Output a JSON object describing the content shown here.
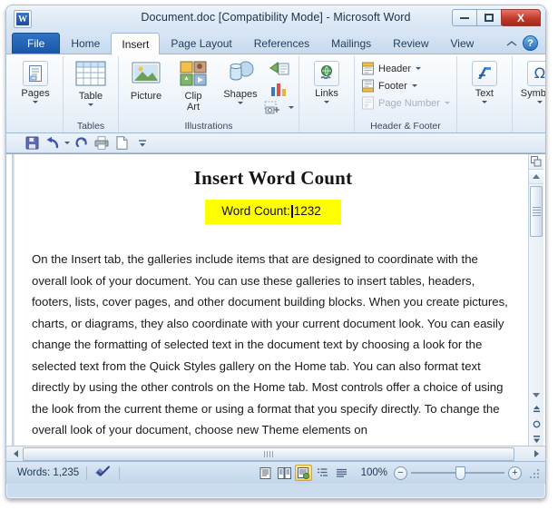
{
  "window": {
    "title": "Document.doc [Compatibility Mode]  -  Microsoft Word",
    "logo_letter": "W",
    "minimize_label": "Minimize",
    "maximize_label": "Restore",
    "close_label": "X"
  },
  "tabs": [
    {
      "label": "File",
      "type": "file"
    },
    {
      "label": "Home",
      "type": "normal"
    },
    {
      "label": "Insert",
      "type": "active"
    },
    {
      "label": "Page Layout",
      "type": "normal"
    },
    {
      "label": "References",
      "type": "normal"
    },
    {
      "label": "Mailings",
      "type": "normal"
    },
    {
      "label": "Review",
      "type": "normal"
    },
    {
      "label": "View",
      "type": "normal"
    }
  ],
  "tabstrip": {
    "collapse_ribbon_icon": "chevron-up-icon",
    "help_label": "?"
  },
  "ribbon": {
    "groups": [
      {
        "label": "",
        "buttons": [
          {
            "label": "Pages",
            "icon": "pages-icon",
            "dropdown": true
          }
        ]
      },
      {
        "label": "Tables",
        "buttons": [
          {
            "label": "Table",
            "icon": "table-icon",
            "dropdown": true
          }
        ]
      },
      {
        "label": "Illustrations",
        "buttons": [
          {
            "label": "Picture",
            "icon": "picture-icon",
            "dropdown": false
          },
          {
            "label": "Clip\nArt",
            "icon": "clip-art-icon",
            "dropdown": false
          },
          {
            "label": "Shapes",
            "icon": "shapes-icon",
            "dropdown": true
          },
          {
            "label": "",
            "icon": "smartart-chart-screenshot-icons",
            "dropdown": false
          }
        ]
      },
      {
        "label": "",
        "buttons": [
          {
            "label": "Links",
            "icon": "links-icon",
            "dropdown": true
          }
        ]
      },
      {
        "label": "Header & Footer",
        "small_buttons": [
          {
            "label": "Header",
            "icon": "header-icon",
            "dropdown": true,
            "disabled": false
          },
          {
            "label": "Footer",
            "icon": "footer-icon",
            "dropdown": true,
            "disabled": false
          },
          {
            "label": "Page Number",
            "icon": "page-number-icon",
            "dropdown": true,
            "disabled": true
          }
        ]
      },
      {
        "label": "",
        "buttons": [
          {
            "label": "Text",
            "icon": "text-icon",
            "dropdown": true
          }
        ]
      },
      {
        "label": "",
        "buttons": [
          {
            "label": "Symbols",
            "icon": "omega-symbol-icon",
            "dropdown": true
          }
        ]
      }
    ]
  },
  "quick_access_toolbar": {
    "items": [
      {
        "name": "save-icon",
        "tooltip": "Save"
      },
      {
        "name": "undo-icon",
        "tooltip": "Undo"
      },
      {
        "name": "undo-dropdown-icon",
        "tooltip": "Undo history"
      },
      {
        "name": "redo-icon",
        "tooltip": "Redo"
      },
      {
        "name": "print-preview-icon",
        "tooltip": "Print Preview and Print"
      },
      {
        "name": "new-document-icon",
        "tooltip": "New"
      },
      {
        "name": "customize-toolbar-icon",
        "tooltip": "Customize Quick Access Toolbar"
      }
    ]
  },
  "document": {
    "heading": "Insert Word Count",
    "highlight_label": "Word Count:",
    "highlight_value": "1232",
    "highlight_color": "#FFFF00",
    "body": "On the Insert tab, the galleries include items that are designed to coordinate with the overall look of your document. You can use these galleries to insert tables, headers, footers, lists, cover pages, and other document building blocks. When you create pictures, charts, or diagrams, they also coordinate with your current document look. You can easily change the formatting of selected text in the document text by choosing a look for the selected text from the Quick Styles gallery on the Home tab. You can also format text directly by using the other controls on the Home tab. Most controls offer a choice of using the look from the current theme or using a format that you specify directly. To change the overall look of your document, choose new Theme elements on"
  },
  "scrollbars": {
    "vertical": {
      "ruler_toggle_icon": "view-ruler-icon",
      "up_arrow_icon": "arrow-up-icon",
      "down_arrow_icon": "arrow-down-icon",
      "previous_page_icon": "previous-page-icon",
      "select_browse_object_icon": "select-browse-object-icon",
      "next_page_icon": "next-page-icon"
    },
    "horizontal": {
      "left_arrow_icon": "arrow-left-icon",
      "right_arrow_icon": "arrow-right-icon"
    }
  },
  "status_bar": {
    "word_count": "Words: 1,235",
    "proofing_icon": "proofing-errors-icon",
    "view_buttons": [
      {
        "name": "print-layout-view",
        "selected": false
      },
      {
        "name": "full-screen-reading-view",
        "selected": false
      },
      {
        "name": "web-layout-view",
        "selected": true
      },
      {
        "name": "outline-view",
        "selected": false
      },
      {
        "name": "draft-view",
        "selected": false
      }
    ],
    "zoom_level": "100%",
    "zoom_out_label": "−",
    "zoom_in_label": "+"
  }
}
